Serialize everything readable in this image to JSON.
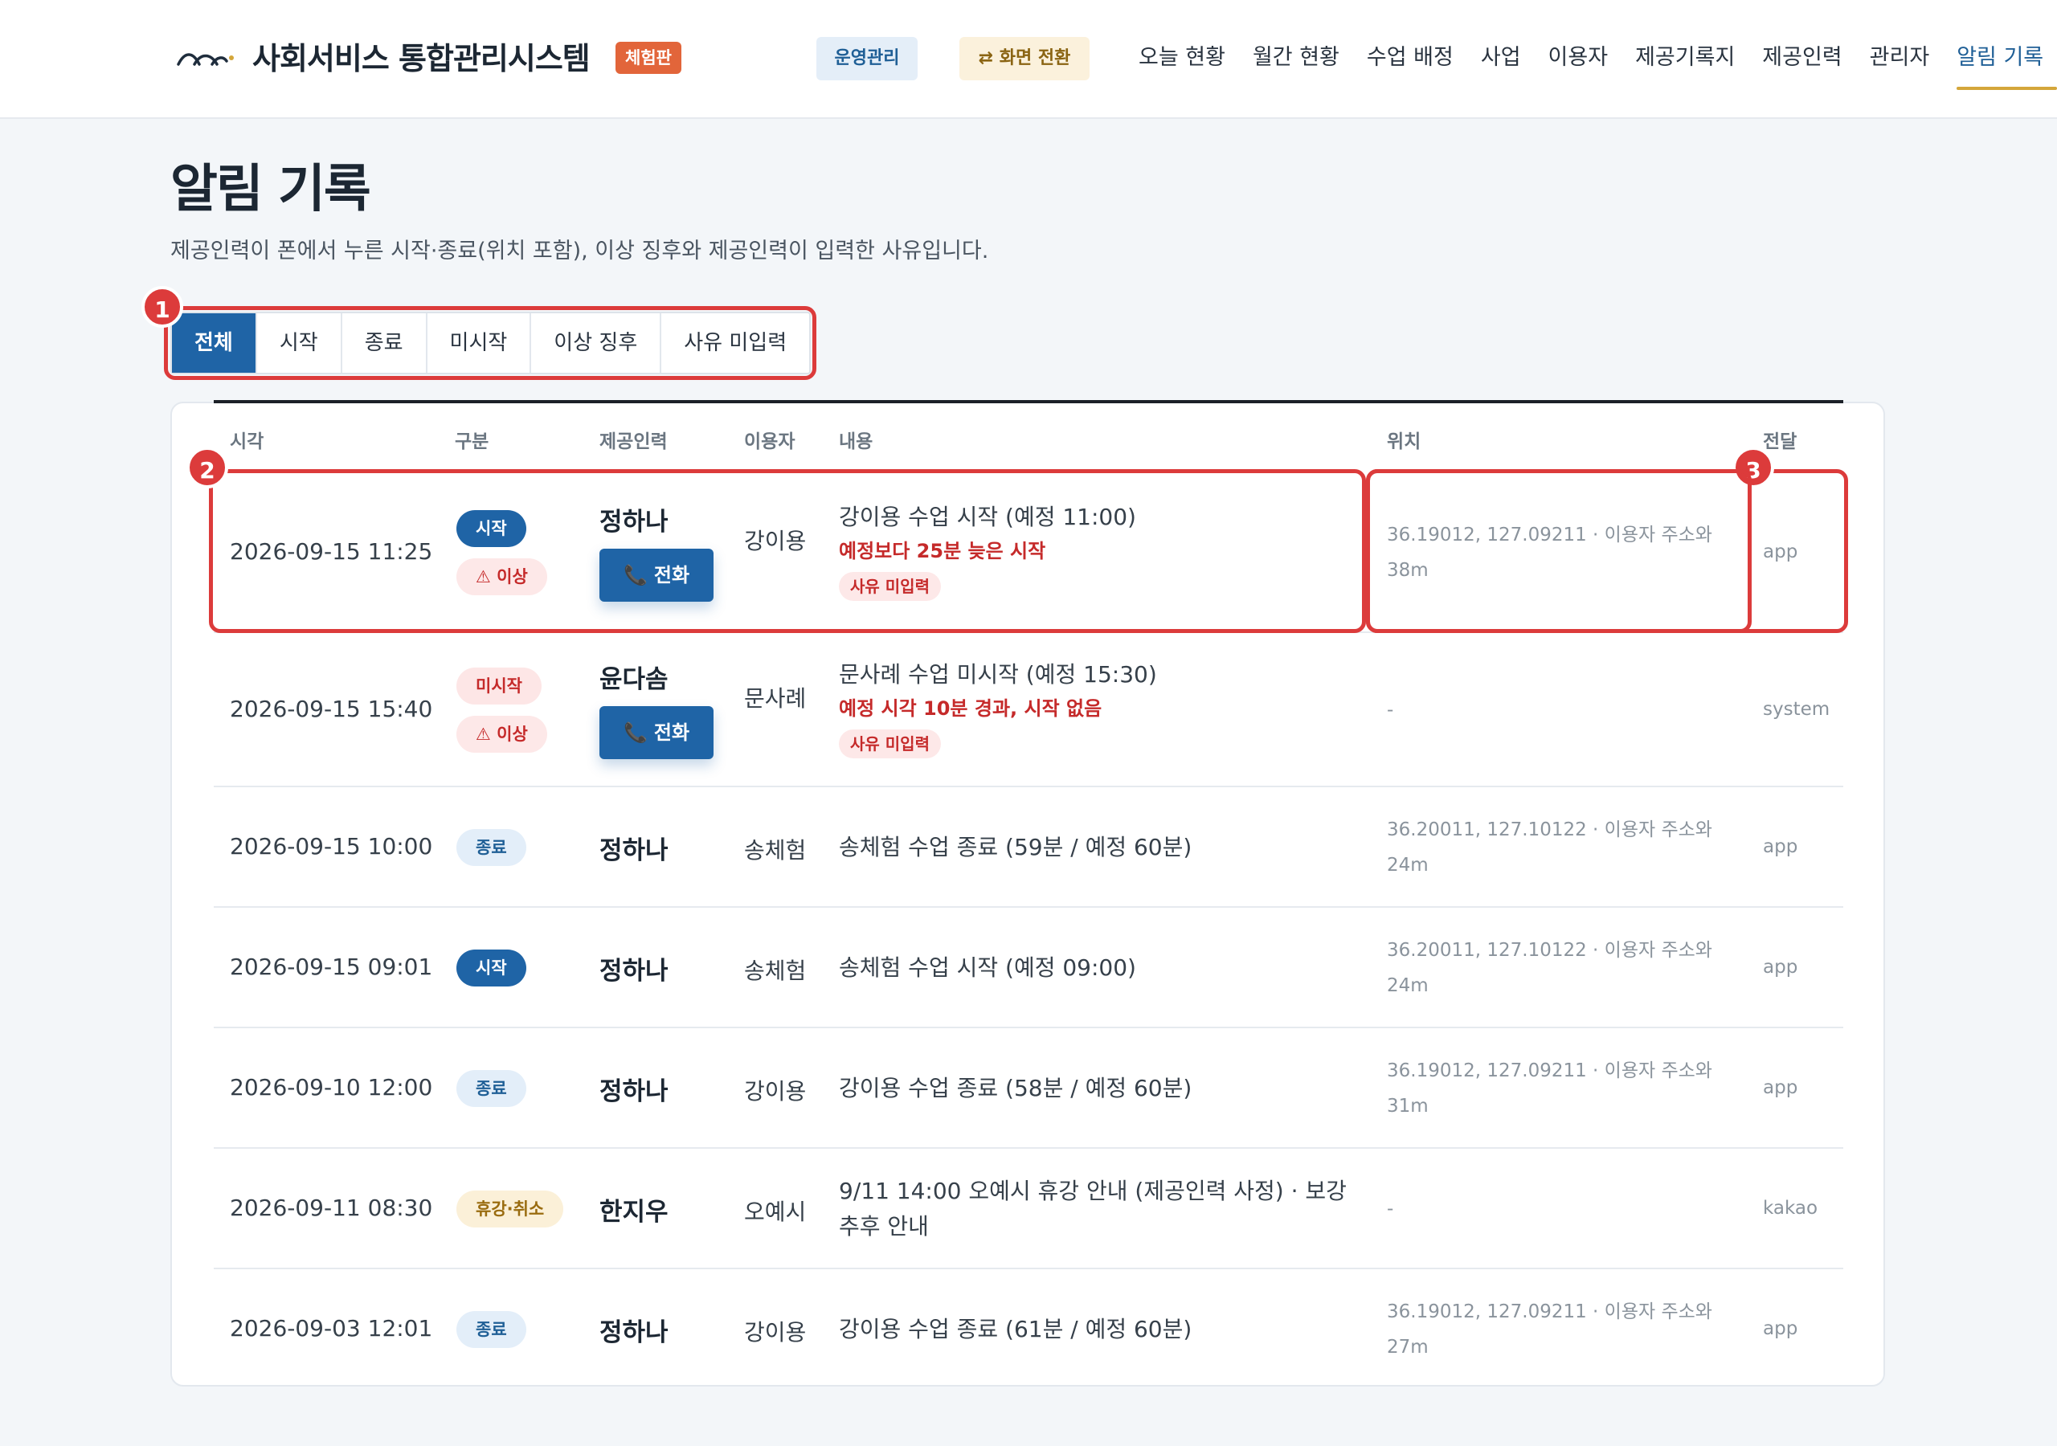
{
  "header": {
    "app_title": "사회서비스 통합관리시스템",
    "trial_badge": "체험판",
    "ops_button": "운영관리",
    "switch_button": "⇄ 화면 전환",
    "nav": [
      "오늘 현황",
      "월간 현황",
      "수업 배정",
      "사업",
      "이용자",
      "제공기록지",
      "제공인력",
      "관리자",
      "알림 기록"
    ],
    "active_nav": "알림 기록"
  },
  "page": {
    "title": "알림 기록",
    "subtitle": "제공인력이 폰에서 누른 시작·종료(위치 포함), 이상 징후와 제공인력이 입력한 사유입니다."
  },
  "filters": [
    "전체",
    "시작",
    "종료",
    "미시작",
    "이상 징후",
    "사유 미입력"
  ],
  "active_filter": "전체",
  "table": {
    "headers": [
      "시각",
      "구분",
      "제공인력",
      "이용자",
      "내용",
      "위치",
      "전달"
    ],
    "call_label": "전화",
    "rows": [
      {
        "time": "2026-09-15 11:25",
        "tags": [
          {
            "label": "시작",
            "type": "start"
          },
          {
            "label": "⚠ 이상",
            "type": "abn"
          }
        ],
        "staff": "정하나",
        "has_call": true,
        "user": "강이용",
        "content": "강이용 수업 시작 (예정 11:00)",
        "warning": "예정보다 25분 늦은 시작",
        "reason": "사유 미입력",
        "location": "36.19012, 127.09211 · 이용자 주소와 38m",
        "delivery": "app"
      },
      {
        "time": "2026-09-15 15:40",
        "tags": [
          {
            "label": "미시작",
            "type": "nostart"
          },
          {
            "label": "⚠ 이상",
            "type": "abn"
          }
        ],
        "staff": "윤다솜",
        "has_call": true,
        "user": "문사례",
        "content": "문사례 수업 미시작 (예정 15:30)",
        "warning": "예정 시각 10분 경과, 시작 없음",
        "reason": "사유 미입력",
        "location": "-",
        "delivery": "system"
      },
      {
        "time": "2026-09-15 10:00",
        "tags": [
          {
            "label": "종료",
            "type": "end"
          }
        ],
        "staff": "정하나",
        "has_call": false,
        "user": "송체험",
        "content": "송체험 수업 종료 (59분 / 예정 60분)",
        "location": "36.20011, 127.10122 · 이용자 주소와 24m",
        "delivery": "app"
      },
      {
        "time": "2026-09-15 09:01",
        "tags": [
          {
            "label": "시작",
            "type": "start"
          }
        ],
        "staff": "정하나",
        "has_call": false,
        "user": "송체험",
        "content": "송체험 수업 시작 (예정 09:00)",
        "location": "36.20011, 127.10122 · 이용자 주소와 24m",
        "delivery": "app"
      },
      {
        "time": "2026-09-10 12:00",
        "tags": [
          {
            "label": "종료",
            "type": "end"
          }
        ],
        "staff": "정하나",
        "has_call": false,
        "user": "강이용",
        "content": "강이용 수업 종료 (58분 / 예정 60분)",
        "location": "36.19012, 127.09211 · 이용자 주소와 31m",
        "delivery": "app"
      },
      {
        "time": "2026-09-11 08:30",
        "tags": [
          {
            "label": "휴강·취소",
            "type": "cancel"
          }
        ],
        "staff": "한지우",
        "has_call": false,
        "user": "오예시",
        "content": "9/11 14:00 오예시 휴강 안내 (제공인력 사정) · 보강 추후 안내",
        "location": "-",
        "delivery": "kakao"
      },
      {
        "time": "2026-09-03 12:01",
        "tags": [
          {
            "label": "종료",
            "type": "end"
          }
        ],
        "staff": "정하나",
        "has_call": false,
        "user": "강이용",
        "content": "강이용 수업 종료 (61분 / 예정 60분)",
        "location": "36.19012, 127.09211 · 이용자 주소와 27m",
        "delivery": "app"
      }
    ]
  },
  "annotations": [
    "1",
    "2",
    "3"
  ],
  "colors": {
    "primary": "#1f64a6",
    "accent_underline": "#d4a63a",
    "trial_badge": "#e2653a",
    "callout": "#dc3b3b",
    "warning_text": "#c52a2a"
  }
}
